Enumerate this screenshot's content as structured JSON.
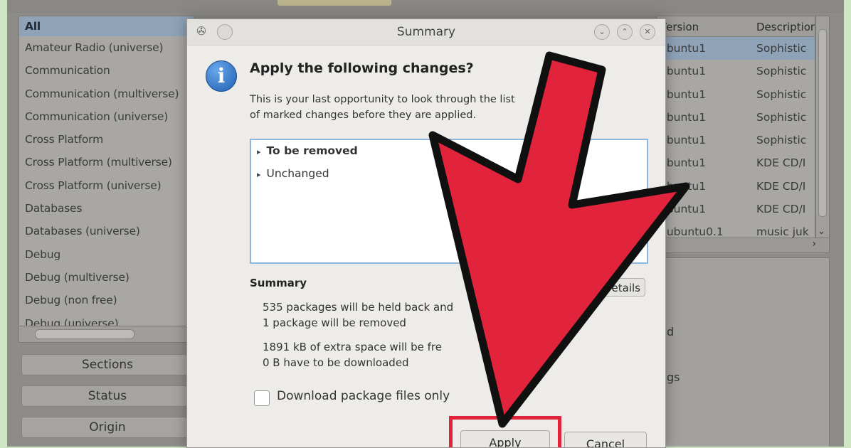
{
  "sections": {
    "items": [
      "All",
      "Amateur Radio (universe)",
      "Communication",
      "Communication (multiverse)",
      "Communication (universe)",
      "Cross Platform",
      "Cross Platform (multiverse)",
      "Cross Platform (universe)",
      "Databases",
      "Databases (universe)",
      "Debug",
      "Debug (multiverse)",
      "Debug (non free)",
      "Debug (universe)"
    ],
    "selected": "All"
  },
  "filters": {
    "sections": "Sections",
    "status": "Status",
    "origin": "Origin"
  },
  "packages": {
    "columns": {
      "version": "Version",
      "description": "Description"
    },
    "rows": [
      {
        "version": "ubuntu1",
        "description": "Sophistic"
      },
      {
        "version": "ubuntu1",
        "description": "Sophistic"
      },
      {
        "version": "ubuntu1",
        "description": "Sophistic"
      },
      {
        "version": "ubuntu1",
        "description": "Sophistic"
      },
      {
        "version": "ubuntu1",
        "description": "Sophistic"
      },
      {
        "version": "ubuntu1",
        "description": "KDE CD/I"
      },
      {
        "version": "ubuntu1",
        "description": "KDE CD/I"
      },
      {
        "version": "ubuntu1",
        "description": "KDE CD/I"
      },
      {
        "version": "0ubuntu0.1",
        "description": "music juk"
      }
    ]
  },
  "detail_fragments": {
    "a": "d",
    "b": "gs"
  },
  "dialog": {
    "title": "Summary",
    "heading": "Apply the following changes?",
    "description_line1": "This is your last opportunity to look through the list",
    "description_line2": "of marked changes before they are applied.",
    "tree": [
      "To be removed",
      "Unchanged"
    ],
    "summary_label": "Summary",
    "summary_lines": [
      "535 packages will be held back and",
      "1 package will be removed",
      "1891 kB of extra space will be fre",
      "0  B have to be downloaded"
    ],
    "details_button": "etails",
    "download_only_label": "Download package files only",
    "download_only_checked": false,
    "apply_button": "Apply",
    "cancel_button": "Cancel"
  },
  "colors": {
    "annotation_red": "#e2233c",
    "selection_blue": "#8fa3b8"
  }
}
